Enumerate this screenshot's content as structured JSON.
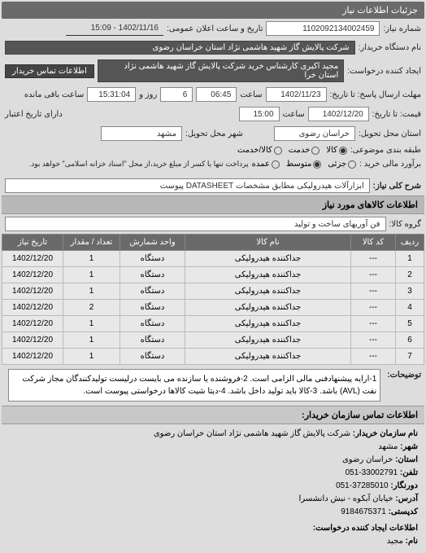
{
  "header": {
    "title": "جزئیات اطلاعات نیاز"
  },
  "requestNumber": {
    "label": "شماره نیاز:",
    "value": "1102092134002459"
  },
  "announceDate": {
    "label": "تاریخ و ساعت اعلان عمومی:",
    "value": "1402/11/16 - 15:09"
  },
  "buyerOrg": {
    "label": "نام دستگاه خریدار:",
    "value": "شرکت پالایش گاز شهید هاشمی نژاد   استان خراسان رضوی"
  },
  "creator": {
    "label": "ایجاد کننده درخواست:",
    "value": "مجید اکبری کارشناس خرید شرکت پالایش گاز شهید هاشمی نژاد   استان خرا"
  },
  "contactBtn": "اطلاعات تماس خریدار",
  "deadline": {
    "label": "مهلت ارسال پاسخ: تا تاریخ:",
    "date": "1402/11/23",
    "timeLabel": "ساعت",
    "time": "06:45",
    "daysValue": "6",
    "daysLabel": "روز و",
    "remainValue": "15:31:04",
    "remainLabel": "ساعت باقی مانده"
  },
  "price": {
    "label": "قیمت: تا تاریخ:",
    "date": "1402/12/20",
    "timeLabel": "ساعت",
    "time": "15:00",
    "validLabel": "دارای تاریخ اعتبار"
  },
  "location": {
    "provinceLabel": "استان محل تحویل:",
    "province": "خراسان رضوی",
    "cityLabel": "شهر محل تحویل:",
    "city": "مشهد"
  },
  "budgetScale": {
    "label": "طبقه بندی موضوعی:",
    "options": [
      "کالا",
      "خدمت",
      "کالا/خدمت"
    ],
    "selected": 0
  },
  "purchaseScale": {
    "label": "برآورد مالی خرید :",
    "options": [
      "جزئی",
      "متوسط",
      "عمده"
    ],
    "selected": 1,
    "note": "پرداخت تنها با کسر از مبلغ خرید،از محل \"اسناد خزانه اسلامی\" خواهد بود."
  },
  "subject": {
    "label": "شرح کلی نیاز:",
    "value": "ابزارآلات هیدرولیکی مطابق مشخصات DATASHEET پیوست"
  },
  "itemsTitle": "اطلاعات کالاهای مورد نیاز",
  "itemsTable": {
    "groupLabel": "گروه کالا:",
    "groupValue": "فن آوریهای ساخت و تولید",
    "headers": [
      "ردیف",
      "کد کالا",
      "نام کالا",
      "واحد شمارش",
      "تعداد / مقدار",
      "تاریخ نیاز"
    ],
    "rows": [
      [
        "1",
        "---",
        "جداکننده هیدرولیکی",
        "دستگاه",
        "1",
        "1402/12/20"
      ],
      [
        "2",
        "---",
        "جداکننده هیدرولیکی",
        "دستگاه",
        "1",
        "1402/12/20"
      ],
      [
        "3",
        "---",
        "جداکننده هیدرولیکی",
        "دستگاه",
        "1",
        "1402/12/20"
      ],
      [
        "4",
        "---",
        "جداکننده هیدرولیکی",
        "دستگاه",
        "2",
        "1402/12/20"
      ],
      [
        "5",
        "---",
        "جداکننده هیدرولیکی",
        "دستگاه",
        "1",
        "1402/12/20"
      ],
      [
        "6",
        "---",
        "جداکننده هیدرولیکی",
        "دستگاه",
        "1",
        "1402/12/20"
      ],
      [
        "7",
        "---",
        "جداکننده هیدرولیکی",
        "دستگاه",
        "1",
        "1402/12/20"
      ]
    ]
  },
  "notes": {
    "label": "توضیحات:",
    "text": "1-ارایه پیشنهادفنی مالی الزامی است. 2-فروشنده یا سازنده می بایست درلیست تولیدکنندگان مجاز شرکت نفت (AVL) باشد. 3-کالا باید تولید داخل باشد. 4-دیتا شیت کالاها درخواستی پیوست است."
  },
  "contactTitle": "اطلاعات تماس سازمان خریدار:",
  "contact": {
    "orgLabel": "نام سازمان خریدار:",
    "org": "شرکت پالایش گاز شهید هاشمی نژاد استان خراسان رضوی",
    "cityLabel": "شهر:",
    "city": "مشهد",
    "provinceLabel": "استان:",
    "province": "خراسان رضوی",
    "phoneLabel": "تلفن:",
    "phone": "33002791-051",
    "faxLabel": "دورنگار:",
    "fax": "37285010-051",
    "addressLabel": "آدرس:",
    "address": "خیابان آبکوه - نبش دانشسرا",
    "postalLabel": "کدپستی:",
    "postal": "9184675371",
    "creatorLabel": "اطلاعات ایجاد کننده درخواست:",
    "nameLabel": "نام:",
    "name": "مجید"
  }
}
